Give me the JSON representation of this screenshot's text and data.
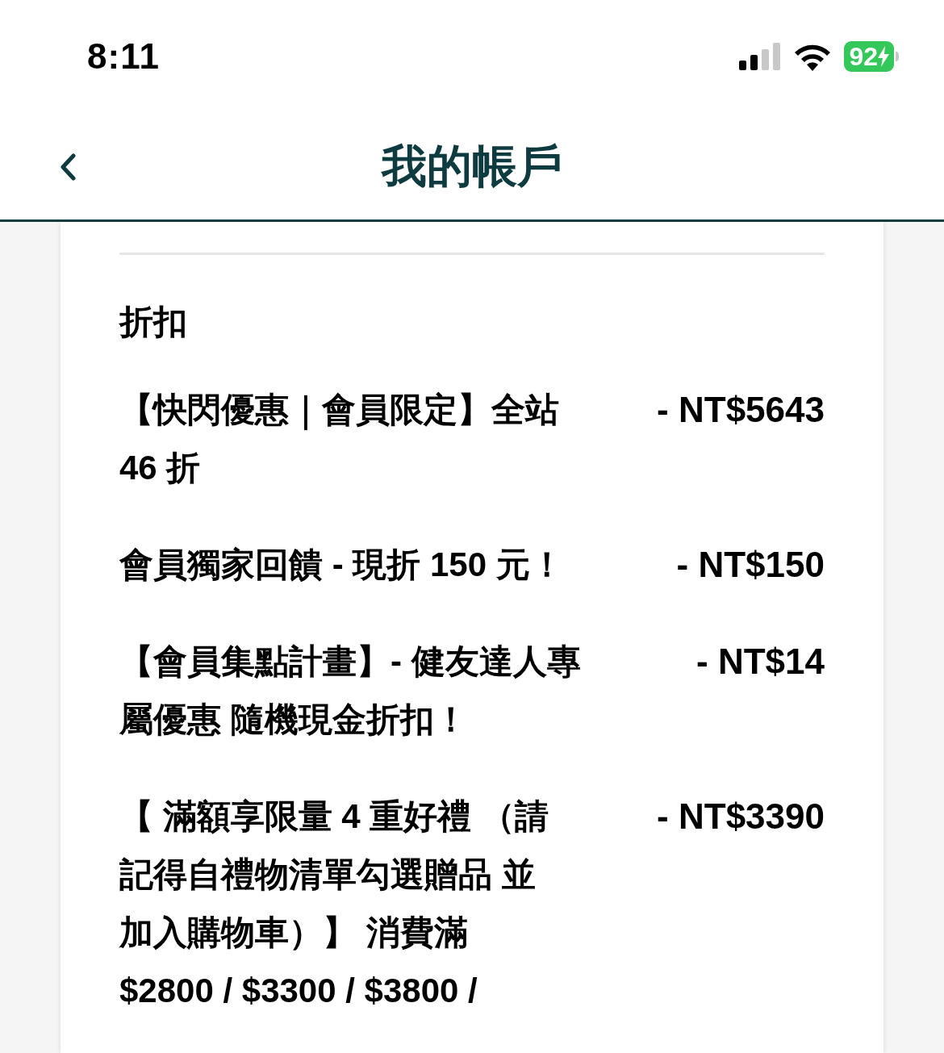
{
  "status_bar": {
    "time": "8:11",
    "battery": "92"
  },
  "header": {
    "title": "我的帳戶"
  },
  "section": {
    "title": "折扣"
  },
  "discounts": [
    {
      "name_lines": [
        "【快閃優惠｜會員限定】全站",
        "46 折"
      ],
      "amount": "- NT$5643"
    },
    {
      "name_lines": [
        "會員獨家回饋 - 現折 150 元！"
      ],
      "amount": "- NT$150"
    },
    {
      "name_lines": [
        "【會員集點計畫】- 健友達人專",
        "屬優惠 隨機現金折扣！"
      ],
      "amount": "- NT$14"
    },
    {
      "name_lines": [
        "【 滿額享限量 4 重好禮 （請",
        "記得自禮物清單勾選贈品 並",
        "加入購物車）】 消費滿",
        "$2800 / $3300 / $3800 /"
      ],
      "amount": "- NT$3390"
    }
  ]
}
